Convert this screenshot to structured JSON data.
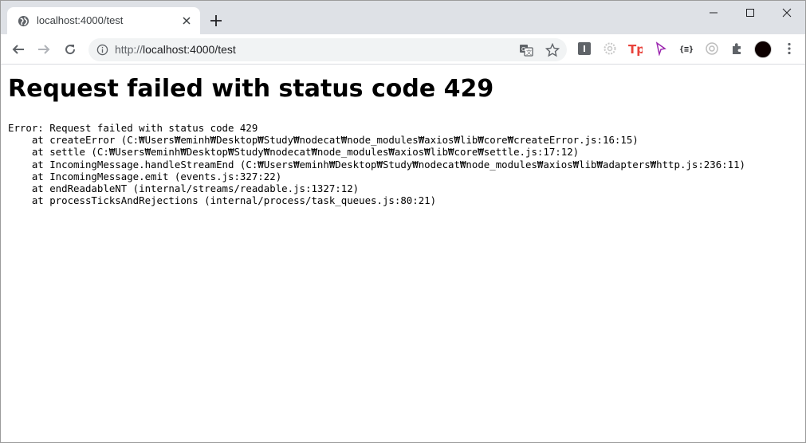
{
  "tab": {
    "title": "localhost:4000/test",
    "favicon": "globe-icon"
  },
  "address_bar": {
    "url_scheme": "http://",
    "url_rest": "localhost:4000/test"
  },
  "extensions": [
    "extension-grey-square-icon",
    "extension-gear-icon",
    "extension-tp-icon",
    "extension-cursor-icon",
    "extension-json-braces-icon",
    "extension-camera-icon",
    "extensions-puzzle-icon"
  ],
  "page": {
    "title": "Request failed with status code 429",
    "stack_lines": [
      "Error: Request failed with status code 429",
      "    at createError (C:₩Users₩eminh₩Desktop₩Study₩nodecat₩node_modules₩axios₩lib₩core₩createError.js:16:15)",
      "    at settle (C:₩Users₩eminh₩Desktop₩Study₩nodecat₩node_modules₩axios₩lib₩core₩settle.js:17:12)",
      "    at IncomingMessage.handleStreamEnd (C:₩Users₩eminh₩Desktop₩Study₩nodecat₩node_modules₩axios₩lib₩adapters₩http.js:236:11)",
      "    at IncomingMessage.emit (events.js:327:22)",
      "    at endReadableNT (internal/streams/readable.js:1327:12)",
      "    at processTicksAndRejections (internal/process/task_queues.js:80:21)"
    ]
  },
  "colors": {
    "tabstrip_bg": "#dee1e6",
    "omnibox_bg": "#f1f3f4",
    "tp_extension": "#e8423b",
    "cursor_extension": "#9c27b0"
  }
}
